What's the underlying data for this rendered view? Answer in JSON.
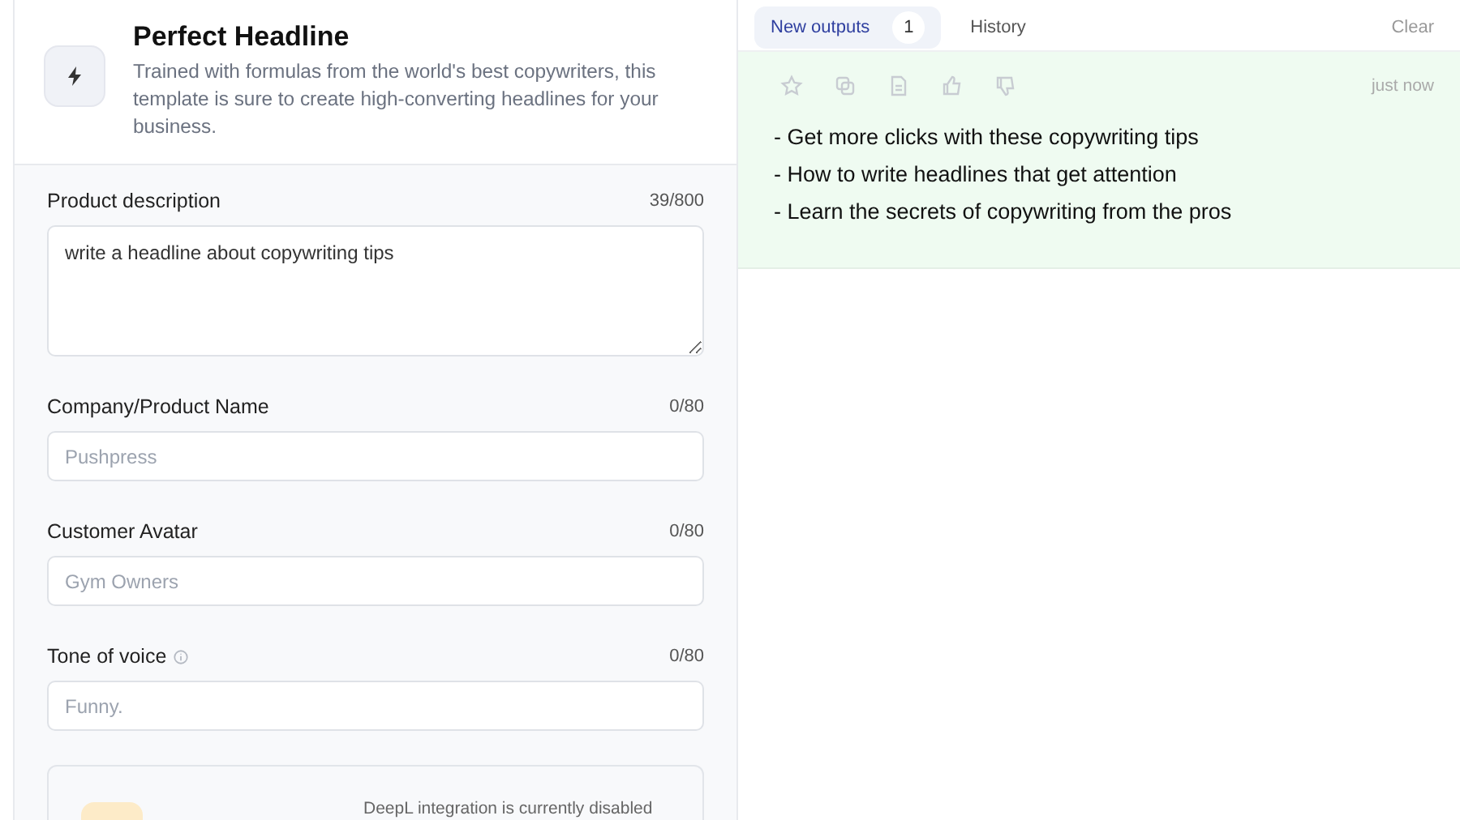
{
  "template": {
    "title": "Perfect Headline",
    "description": "Trained with formulas from the world's best copywriters, this template is sure to create high-converting headlines for your business."
  },
  "fields": [
    {
      "kind": "textarea",
      "label": "Product description",
      "counter": "39/800",
      "value": "write a headline about copywriting tips",
      "info": false
    },
    {
      "kind": "input",
      "label": "Company/Product Name",
      "counter": "0/80",
      "placeholder": "Pushpress",
      "info": false
    },
    {
      "kind": "input",
      "label": "Customer Avatar",
      "counter": "0/80",
      "placeholder": "Gym Owners",
      "info": false
    },
    {
      "kind": "input",
      "label": "Tone of voice",
      "counter": "0/80",
      "placeholder": "Funny.",
      "info": true
    }
  ],
  "integration_notice": "DeepL integration is currently disabled",
  "tabs": [
    {
      "label": "New outputs",
      "badge": "1",
      "selected": true
    },
    {
      "label": "History",
      "selected": false
    }
  ],
  "clear_button": "Clear",
  "output": {
    "time": "just now",
    "lines": [
      "- Get more clicks with these copywriting tips",
      "- How to write headlines that get attention",
      "- Learn the secrets of copywriting from the pros"
    ]
  }
}
